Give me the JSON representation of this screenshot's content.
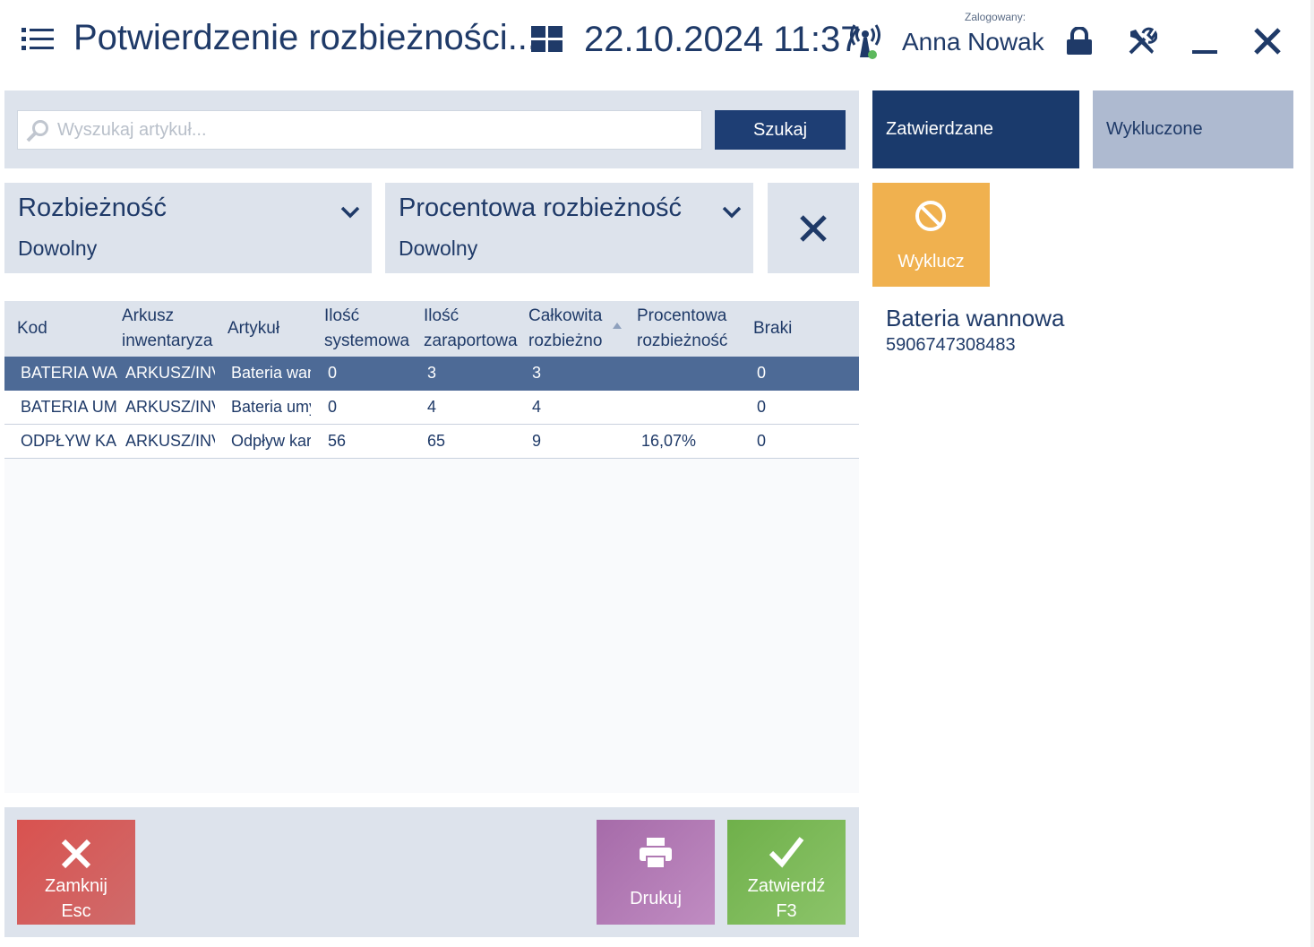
{
  "header": {
    "title": "Potwierdzenie rozbieżności...",
    "datetime": "22.10.2024 11:37",
    "logged_label": "Zalogowany:",
    "user_name": "Anna Nowak"
  },
  "search": {
    "placeholder": "Wyszukaj artykuł...",
    "button_label": "Szukaj"
  },
  "tabs": [
    {
      "label": "Zatwierdzane",
      "active": true
    },
    {
      "label": "Wykluczone",
      "active": false
    }
  ],
  "filters": [
    {
      "title": "Rozbieżność",
      "value": "Dowolny"
    },
    {
      "title": "Procentowa rozbieżność",
      "value": "Dowolny"
    }
  ],
  "actions": {
    "exclude_label": "Wyklucz"
  },
  "detail": {
    "name": "Bateria wannowa",
    "code": "5906747308483"
  },
  "grid": {
    "columns": [
      {
        "line1": "Kod",
        "line2": ""
      },
      {
        "line1": "Arkusz",
        "line2": "inwentaryza"
      },
      {
        "line1": "Artykuł",
        "line2": ""
      },
      {
        "line1": "Ilość",
        "line2": "systemowa"
      },
      {
        "line1": "Ilość",
        "line2": "zaraportowa"
      },
      {
        "line1": "Całkowita",
        "line2": "rozbieżno"
      },
      {
        "line1": "Procentowa",
        "line2": "rozbieżność"
      },
      {
        "line1": "Braki",
        "line2": ""
      }
    ],
    "rows": [
      {
        "cells": [
          "BATERIA WA",
          "ARKUSZ/INV",
          "Bateria wan",
          "0",
          "3",
          "3",
          "",
          "0"
        ],
        "selected": true
      },
      {
        "cells": [
          "BATERIA UM",
          "ARKUSZ/INV",
          "Bateria umy",
          "0",
          "4",
          "4",
          "",
          "0"
        ],
        "selected": false
      },
      {
        "cells": [
          "ODPŁYW KA",
          "ARKUSZ/INV",
          "Odpływ kar",
          "56",
          "65",
          "9",
          "16,07%",
          "0"
        ],
        "selected": false
      }
    ]
  },
  "bottom": {
    "close_line1": "Zamknij",
    "close_line2": "Esc",
    "print_label": "Drukuj",
    "confirm_line1": "Zatwierdź",
    "confirm_line2": "F3"
  },
  "colors": {
    "primary": "#1a3a6c",
    "panel": "#dde3ec",
    "selected_row": "#4d6a96",
    "exclude": "#f0b14f",
    "close": "#d9524f",
    "print": "#a66ba9",
    "confirm": "#6fb04a"
  }
}
